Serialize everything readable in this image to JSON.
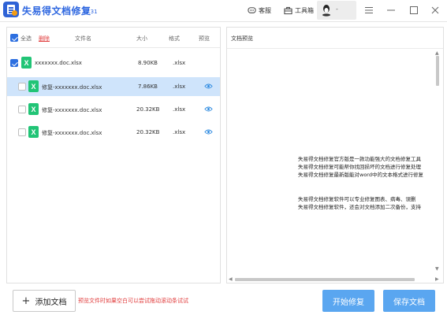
{
  "app": {
    "title": "失易得文档修复",
    "version": "1.31"
  },
  "toolbar": {
    "service_label": "客服",
    "toolbox_label": "工具箱"
  },
  "user": {
    "name": "-"
  },
  "list": {
    "select_all_label": "全选",
    "delete_label": "删除",
    "columns": {
      "name": "文件名",
      "size": "大小",
      "format": "格式",
      "preview": "预览"
    },
    "rows": [
      {
        "name": "xxxxxxx.doc.xlsx",
        "size": "8.90KB",
        "format": ".xlsx",
        "checked": true,
        "selected": false,
        "level": 0,
        "preview": false
      },
      {
        "name": "修复-xxxxxxx.doc.xlsx",
        "size": "7.86KB",
        "format": ".xlsx",
        "checked": false,
        "selected": true,
        "level": 1,
        "preview": true
      },
      {
        "name": "修复-xxxxxxx.doc.xlsx",
        "size": "20.32KB",
        "format": ".xlsx",
        "checked": false,
        "selected": false,
        "level": 1,
        "preview": true
      },
      {
        "name": "修复-xxxxxxx.doc.xlsx",
        "size": "20.32KB",
        "format": ".xlsx",
        "checked": false,
        "selected": false,
        "level": 1,
        "preview": true
      }
    ]
  },
  "preview": {
    "title": "文档预览",
    "lines": [
      "失易得文档修复官方版是一款功能强大的文档修复工具",
      "失易得文档修复可能帮你找回损坏的文档进行修复处理",
      "失易得文档修复最新版能对word中的文本格式进行修复",
      "",
      "失易得文档修复软件可以专业修复图表、病毒、误删",
      "失易得文档修复软件，还会对文档添加二次备份，支持"
    ]
  },
  "footer": {
    "add_label": "添加文档",
    "hint": "预览文件时如果空白可以尝试拖动滚动条试试",
    "start_label": "开始修复",
    "save_label": "保存文档"
  },
  "colors": {
    "accent": "#2e67e0",
    "primary_button": "#5aa6f0",
    "excel_green": "#21c476",
    "hint_red": "#e03b3b",
    "selected_row": "#cfe4fb"
  }
}
